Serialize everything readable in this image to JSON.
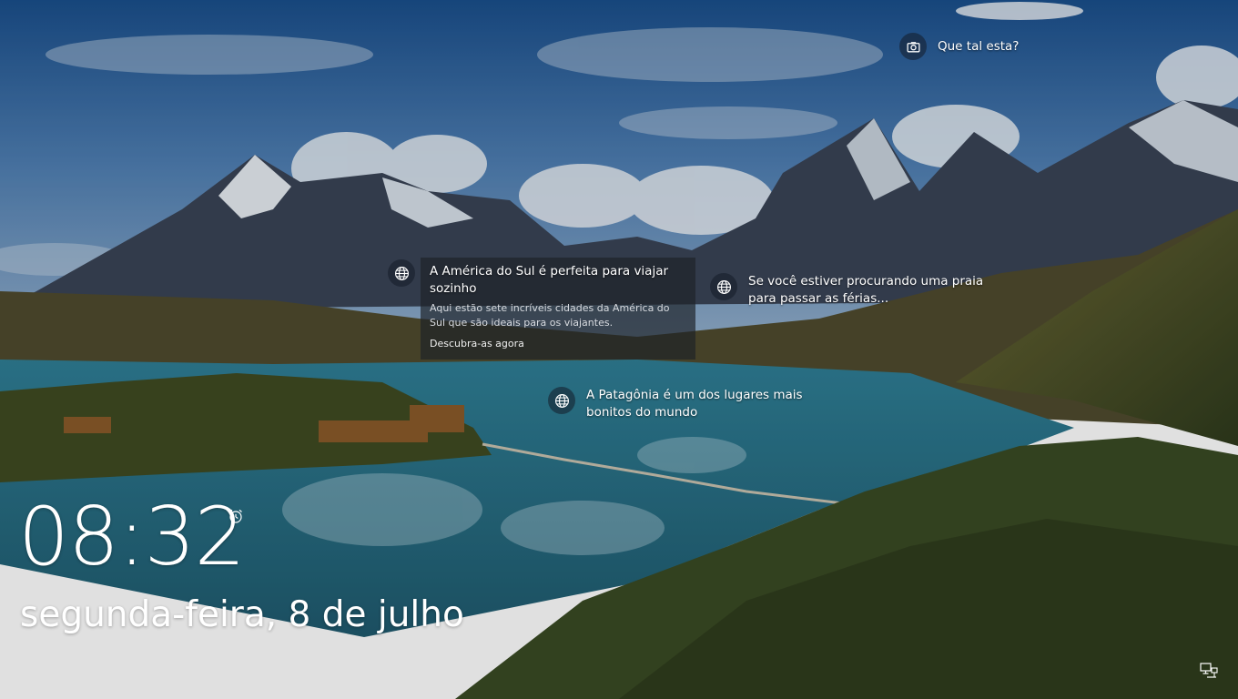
{
  "lockscreen": {
    "time": "08:32",
    "date": "segunda-feira, 8 de julho"
  },
  "spotlight": {
    "photo_prompt": "Que tal esta?",
    "hotspots": [
      {
        "title": "A América do Sul é perfeita para viajar sozinho",
        "description": "Aqui estão sete incríveis cidades da América do Sul que são ideais para os viajantes.",
        "link": "Descubra-as agora",
        "icon": "globe-icon"
      },
      {
        "title": "Se você estiver procurando uma praia para passar as férias...",
        "icon": "globe-icon"
      },
      {
        "title": "A Patagônia é um dos lugares mais bonitos do mundo",
        "icon": "globe-icon"
      }
    ]
  },
  "icons": {
    "photo": "camera-icon",
    "alarm": "alarm-clock-icon",
    "network": "network-icon"
  },
  "colors": {
    "sky_top": "#1f5a99",
    "lake": "#3e8fa6",
    "card_bg": "#1e2228"
  }
}
